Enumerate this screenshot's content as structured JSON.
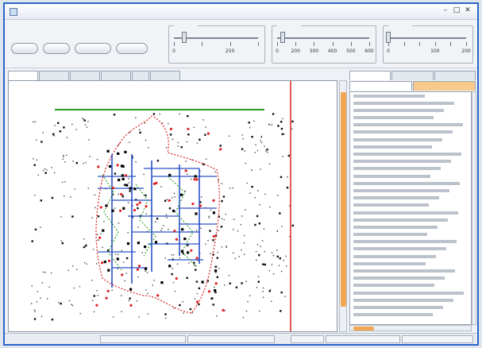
{
  "window": {
    "title": ""
  },
  "toolbar": {
    "buttons": [
      {
        "label": ""
      },
      {
        "label": ""
      },
      {
        "label": ""
      },
      {
        "label": ""
      }
    ],
    "sliders": [
      {
        "legend": "",
        "tick_labels": [
          "0",
          "",
          "250",
          ""
        ],
        "value": 0.12
      },
      {
        "legend": "",
        "tick_labels": [
          "0",
          "200",
          "300",
          "400",
          "500",
          "600"
        ],
        "value": 0.06
      },
      {
        "legend": "",
        "tick_labels": [
          "0",
          "",
          "",
          "100",
          "",
          "200"
        ],
        "value": 0.0
      }
    ]
  },
  "left_tabs": [
    "",
    "",
    "",
    "",
    "",
    ""
  ],
  "right_tabs_top": [
    "",
    "",
    ""
  ],
  "right_tabs_sub": [
    "",
    ""
  ],
  "list": {
    "rows": [
      {
        "text": ""
      },
      {
        "text": ""
      },
      {
        "text": ""
      },
      {
        "text": ""
      },
      {
        "text": ""
      },
      {
        "text": ""
      },
      {
        "text": ""
      },
      {
        "text": ""
      },
      {
        "text": ""
      },
      {
        "text": ""
      },
      {
        "text": ""
      },
      {
        "text": ""
      },
      {
        "text": ""
      },
      {
        "text": ""
      },
      {
        "text": ""
      },
      {
        "text": ""
      },
      {
        "text": ""
      },
      {
        "text": ""
      },
      {
        "text": ""
      },
      {
        "text": ""
      },
      {
        "text": ""
      },
      {
        "text": ""
      },
      {
        "text": ""
      },
      {
        "text": ""
      },
      {
        "text": ""
      },
      {
        "text": ""
      },
      {
        "text": ""
      },
      {
        "text": ""
      },
      {
        "text": ""
      },
      {
        "text": ""
      },
      {
        "text": ""
      }
    ]
  },
  "status": {
    "cells": [
      "",
      "",
      "",
      "",
      ""
    ]
  },
  "colors": {
    "window_border": "#2a66c8",
    "accent_orange": "#f2a650",
    "route_blue": "#2a50c8",
    "route_red": "#e02020",
    "route_green": "#2a9a2a",
    "divider_red": "#e02020"
  }
}
